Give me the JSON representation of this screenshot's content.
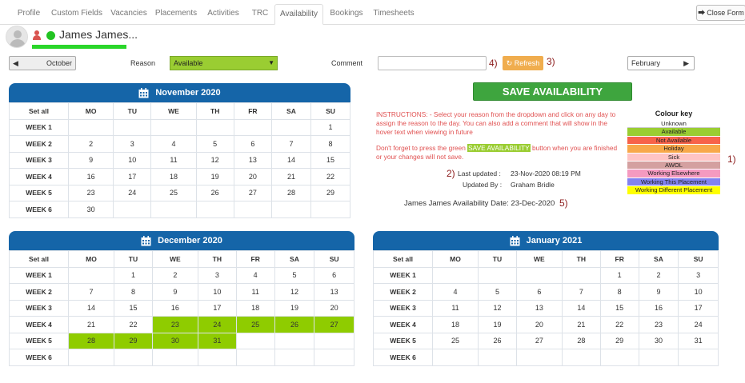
{
  "tabs": [
    "Profile",
    "Custom Fields",
    "Vacancies",
    "Placements",
    "Activities",
    "TRC",
    "Availability",
    "Bookings",
    "Timesheets"
  ],
  "close_label": "Close Form",
  "person": {
    "name": "James James..."
  },
  "controls": {
    "prev_month": "October",
    "reason_label": "Reason",
    "reason_value": "Available",
    "comment_label": "Comment",
    "comment_value": "",
    "refresh_label": "Refresh",
    "next_month": "February"
  },
  "markers": {
    "m1": "1)",
    "m2": "2)",
    "m3": "3)",
    "m4": "4)",
    "m5": "5)"
  },
  "save_label": "SAVE AVAILABILITY",
  "instructions": {
    "line1": "INSTRUCTIONS: - Select your reason from the dropdown and click on any day to assign the reason to the day. You can also add a comment that will show in the hover text when viewing in future",
    "line2_before": "Don't forget to press the green",
    "line2_highlight": "SAVE AVAILABILITY",
    "line2_after": "button when you are finished or your changes will not save."
  },
  "last_updated": {
    "label": "Last updated :",
    "value": "23-Nov-2020 08:19 PM"
  },
  "updated_by": {
    "label": "Updated By :",
    "value": "Graham Bridle"
  },
  "availability_date": "James James Availability Date: 23-Dec-2020",
  "colour_key": {
    "title": "Colour key",
    "items": [
      {
        "label": "Unknown",
        "color": "#ffffff"
      },
      {
        "label": "Available",
        "color": "#9acd32"
      },
      {
        "label": "Not Available",
        "color": "#f7634a"
      },
      {
        "label": "Holiday",
        "color": "#f8a84a"
      },
      {
        "label": "Sick",
        "color": "#ffc4c4"
      },
      {
        "label": "AWOL",
        "color": "#d4a0a0"
      },
      {
        "label": "Working Elsewhere",
        "color": "#f59ac0"
      },
      {
        "label": "Working This Placement",
        "color": "#8282f0"
      },
      {
        "label": "Working Different Placement",
        "color": "#ffff00"
      }
    ]
  },
  "calendar_headers": [
    "Set all",
    "MO",
    "TU",
    "WE",
    "TH",
    "FR",
    "SA",
    "SU"
  ],
  "calendars": [
    {
      "title": "November 2020",
      "rows": [
        {
          "label": "WEEK 1",
          "days": [
            "",
            "",
            "",
            "",
            "",
            "",
            "1"
          ],
          "sel": []
        },
        {
          "label": "WEEK 2",
          "days": [
            "2",
            "3",
            "4",
            "5",
            "6",
            "7",
            "8"
          ],
          "sel": []
        },
        {
          "label": "WEEK 3",
          "days": [
            "9",
            "10",
            "11",
            "12",
            "13",
            "14",
            "15"
          ],
          "sel": []
        },
        {
          "label": "WEEK 4",
          "days": [
            "16",
            "17",
            "18",
            "19",
            "20",
            "21",
            "22"
          ],
          "sel": []
        },
        {
          "label": "WEEK 5",
          "days": [
            "23",
            "24",
            "25",
            "26",
            "27",
            "28",
            "29"
          ],
          "sel": []
        },
        {
          "label": "WEEK 6",
          "days": [
            "30",
            "",
            "",
            "",
            "",
            "",
            ""
          ],
          "sel": []
        }
      ]
    },
    {
      "title": "December 2020",
      "rows": [
        {
          "label": "WEEK 1",
          "days": [
            "",
            "1",
            "2",
            "3",
            "4",
            "5",
            "6"
          ],
          "sel": []
        },
        {
          "label": "WEEK 2",
          "days": [
            "7",
            "8",
            "9",
            "10",
            "11",
            "12",
            "13"
          ],
          "sel": []
        },
        {
          "label": "WEEK 3",
          "days": [
            "14",
            "15",
            "16",
            "17",
            "18",
            "19",
            "20"
          ],
          "sel": []
        },
        {
          "label": "WEEK 4",
          "days": [
            "21",
            "22",
            "23",
            "24",
            "25",
            "26",
            "27"
          ],
          "sel": [
            2,
            3,
            4,
            5,
            6
          ]
        },
        {
          "label": "WEEK 5",
          "days": [
            "28",
            "29",
            "30",
            "31",
            "",
            "",
            ""
          ],
          "sel": [
            0,
            1,
            2,
            3
          ]
        },
        {
          "label": "WEEK 6",
          "days": [
            "",
            "",
            "",
            "",
            "",
            "",
            ""
          ],
          "sel": []
        }
      ]
    },
    {
      "title": "January 2021",
      "rows": [
        {
          "label": "WEEK 1",
          "days": [
            "",
            "",
            "",
            "",
            "1",
            "2",
            "3"
          ],
          "sel": []
        },
        {
          "label": "WEEK 2",
          "days": [
            "4",
            "5",
            "6",
            "7",
            "8",
            "9",
            "10"
          ],
          "sel": []
        },
        {
          "label": "WEEK 3",
          "days": [
            "11",
            "12",
            "13",
            "14",
            "15",
            "16",
            "17"
          ],
          "sel": []
        },
        {
          "label": "WEEK 4",
          "days": [
            "18",
            "19",
            "20",
            "21",
            "22",
            "23",
            "24"
          ],
          "sel": []
        },
        {
          "label": "WEEK 5",
          "days": [
            "25",
            "26",
            "27",
            "28",
            "29",
            "30",
            "31"
          ],
          "sel": []
        },
        {
          "label": "WEEK 6",
          "days": [
            "",
            "",
            "",
            "",
            "",
            "",
            ""
          ],
          "sel": []
        }
      ]
    }
  ]
}
